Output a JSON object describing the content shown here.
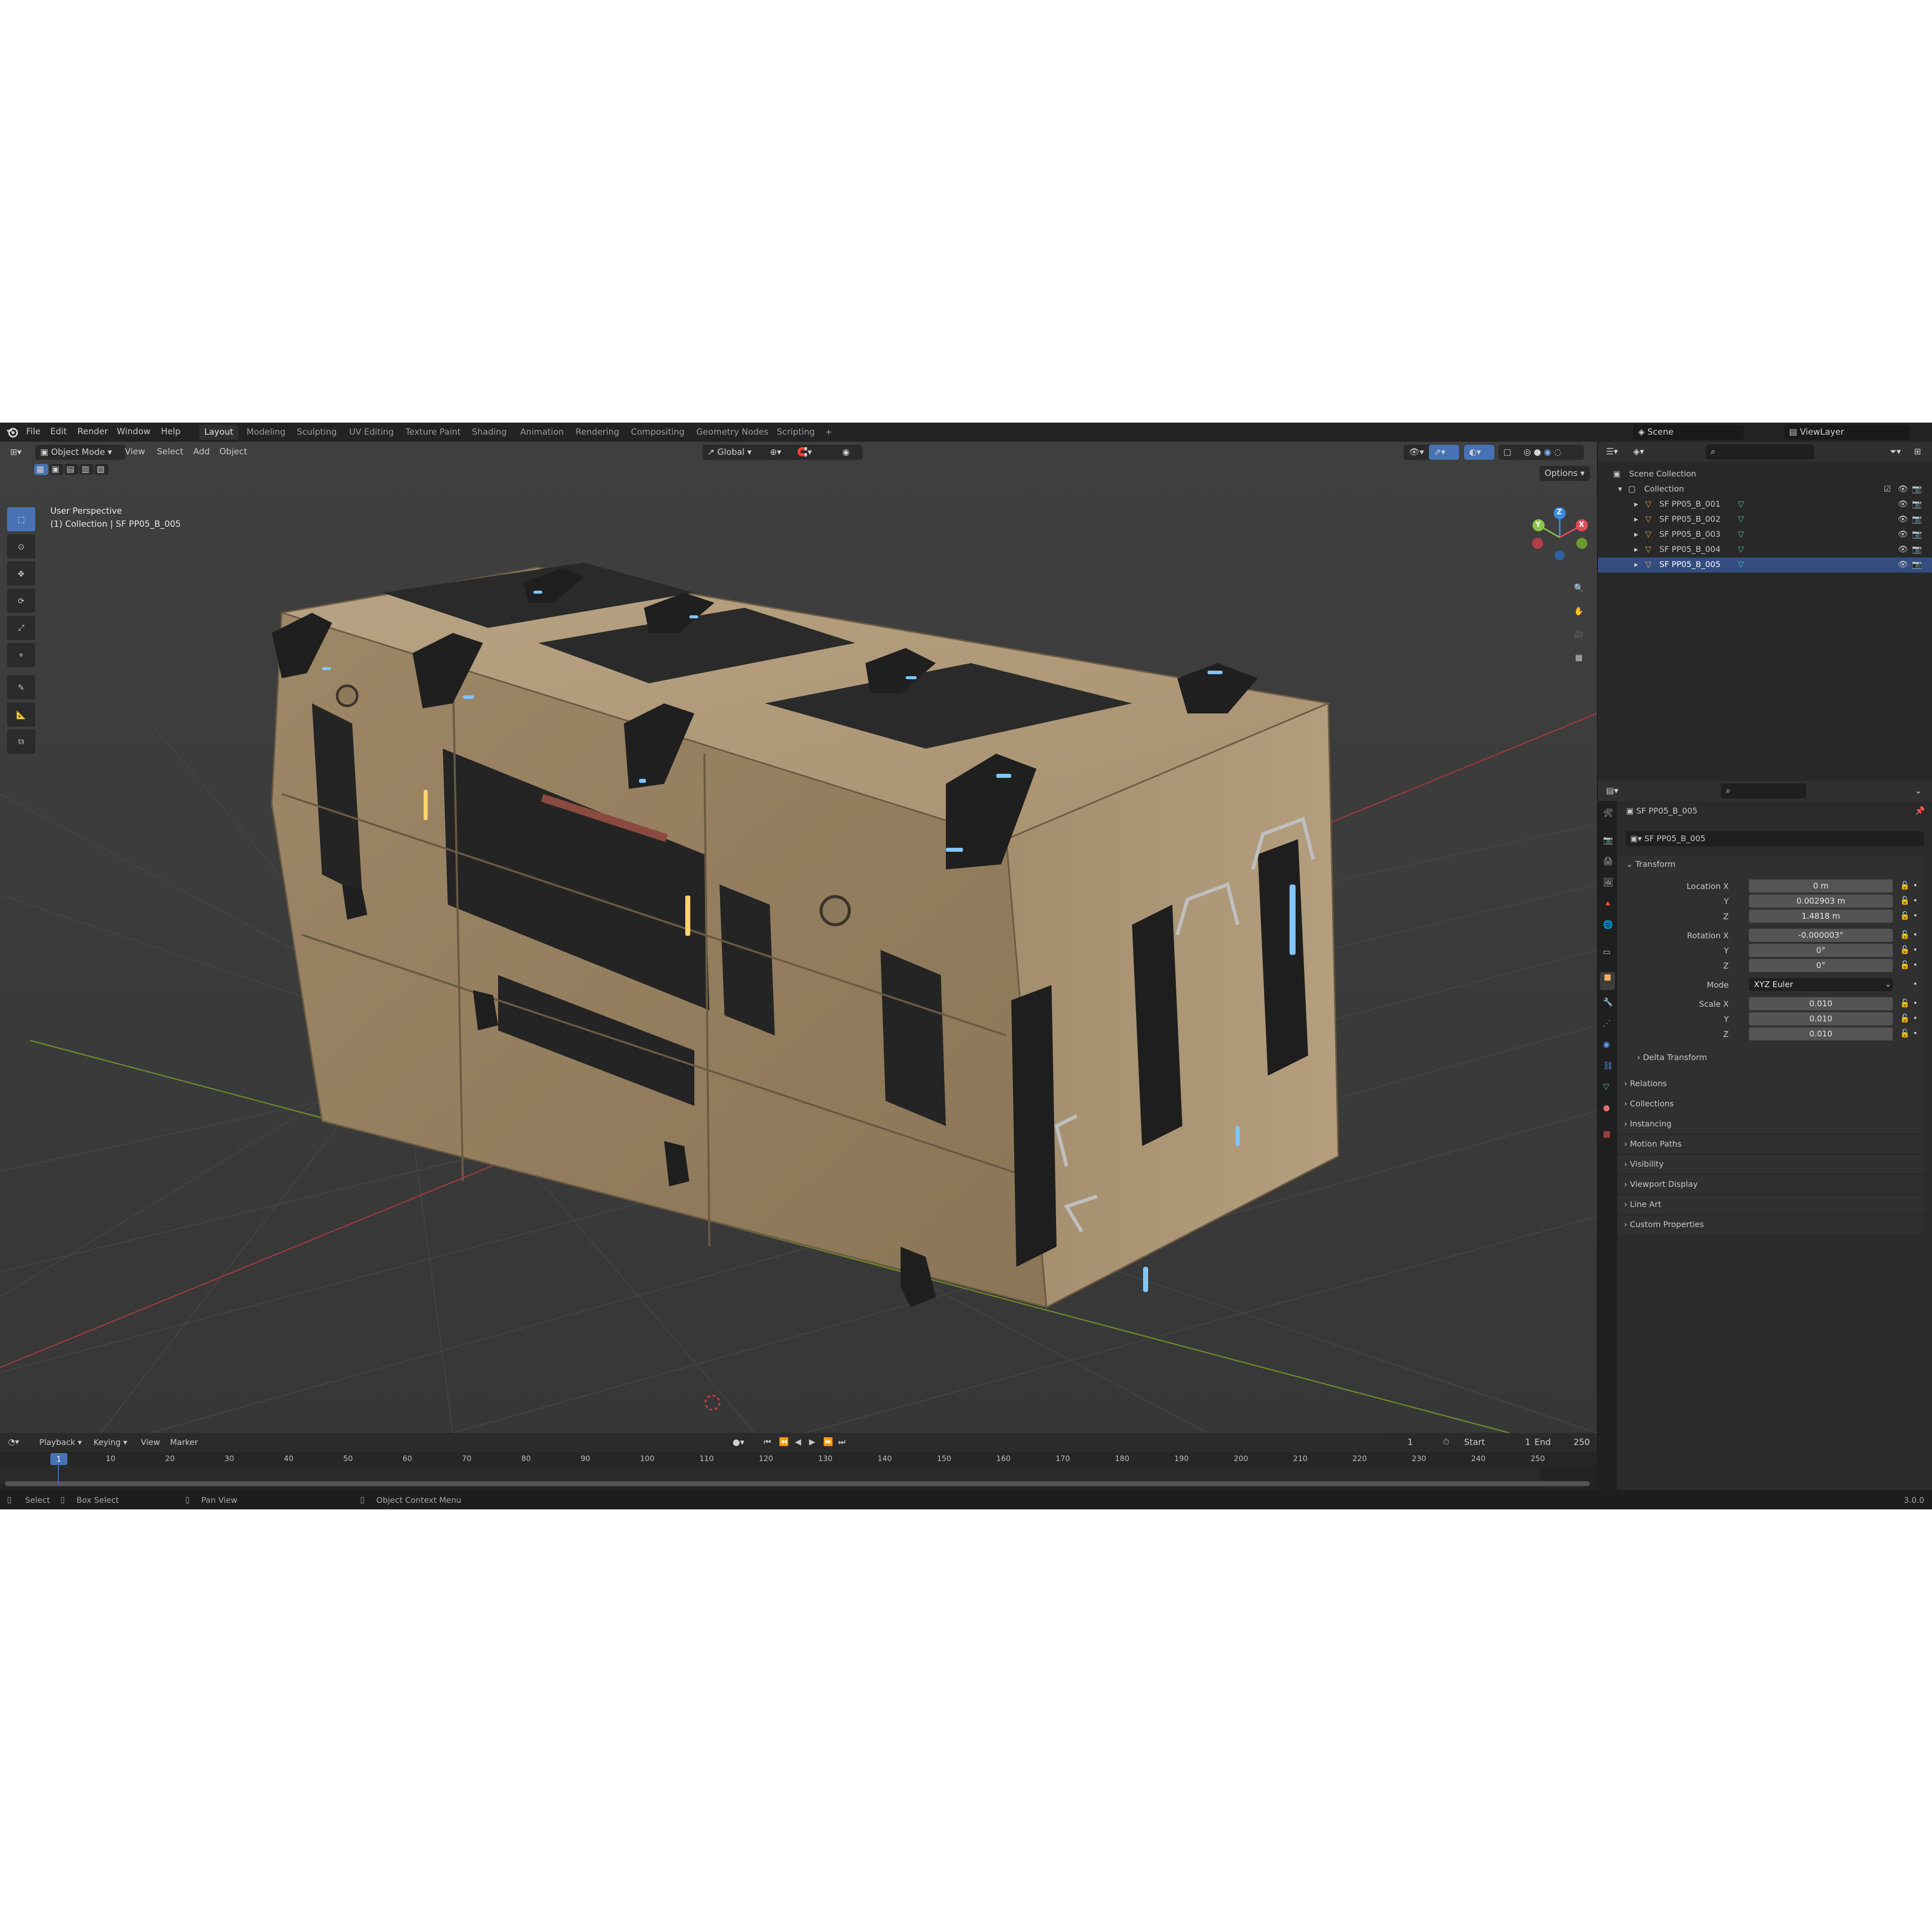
{
  "menu": {
    "file": "File",
    "edit": "Edit",
    "render": "Render",
    "window": "Window",
    "help": "Help"
  },
  "workspaces": [
    "Layout",
    "Modeling",
    "Sculpting",
    "UV Editing",
    "Texture Paint",
    "Shading",
    "Animation",
    "Rendering",
    "Compositing",
    "Geometry Nodes",
    "Scripting"
  ],
  "workspace_add": "+",
  "scene": {
    "name": "Scene",
    "view_layer": "ViewLayer"
  },
  "viewport": {
    "mode": "Object Mode",
    "menu_view": "View",
    "menu_select": "Select",
    "menu_add": "Add",
    "menu_object": "Object",
    "transform_orientation": "Global",
    "options": "Options",
    "overlay_title": "User Perspective",
    "overlay_subtitle": "(1) Collection | SF PP05_B_005",
    "gizmo_axes": {
      "x": "X",
      "y": "Y",
      "z": "Z"
    }
  },
  "outliner": {
    "root": "Scene Collection",
    "collection": "Collection",
    "objects": [
      "SF PP05_B_001",
      "SF PP05_B_002",
      "SF PP05_B_003",
      "SF PP05_B_004",
      "SF PP05_B_005"
    ]
  },
  "properties": {
    "object_name": "SF PP05_B_005",
    "datablock_name": "SF PP05_B_005",
    "transform_header": "Transform",
    "location_label": "Location X",
    "y_label": "Y",
    "z_label": "Z",
    "location": [
      "0 m",
      "0.002903 m",
      "1.4818 m"
    ],
    "rotation_label": "Rotation X",
    "rotation": [
      "-0.000003°",
      "0°",
      "0°"
    ],
    "mode_label": "Mode",
    "mode_value": "XYZ Euler",
    "scale_label": "Scale X",
    "scale": [
      "0.010",
      "0.010",
      "0.010"
    ],
    "delta": "Delta Transform",
    "panels": [
      "Relations",
      "Collections",
      "Instancing",
      "Motion Paths",
      "Visibility",
      "Viewport Display",
      "Line Art",
      "Custom Properties"
    ]
  },
  "timeline": {
    "playback": "Playback",
    "keying": "Keying",
    "view": "View",
    "marker": "Marker",
    "current_frame": "1",
    "start_label": "Start",
    "start": "1",
    "end_label": "End",
    "end": "250",
    "ticks": [
      "1",
      "10",
      "20",
      "30",
      "40",
      "50",
      "60",
      "70",
      "80",
      "90",
      "100",
      "110",
      "120",
      "130",
      "140",
      "150",
      "160",
      "170",
      "180",
      "190",
      "200",
      "210",
      "220",
      "230",
      "240",
      "250"
    ]
  },
  "status": {
    "select": "Select",
    "box_select": "Box Select",
    "pan_view": "Pan View",
    "context_menu": "Object Context Menu",
    "version": "3.0.0"
  },
  "colors": {
    "accent": "#4772b3",
    "x_axis": "#e04b5a",
    "y_axis": "#8bc34a",
    "z_axis": "#3c8be0",
    "crate": "#a08a6b",
    "glow_blue": "#7fc6ff",
    "glow_yellow": "#ffd36b"
  }
}
